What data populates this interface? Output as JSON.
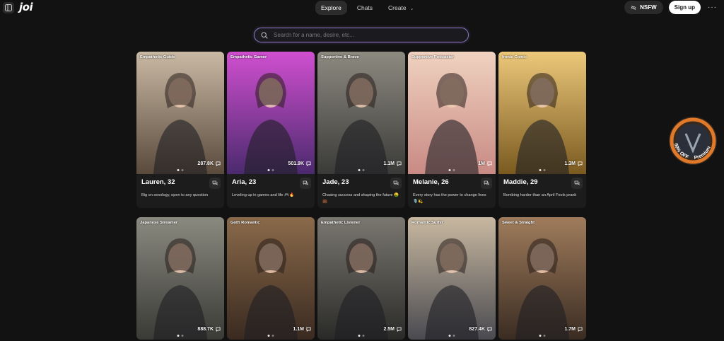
{
  "header": {
    "logo": "joi",
    "nav": [
      {
        "label": "Explore",
        "active": true
      },
      {
        "label": "Chats",
        "active": false
      },
      {
        "label": "Create",
        "active": false
      }
    ],
    "nsfw_label": "NSFW",
    "signup_label": "Sign up",
    "more_label": "···"
  },
  "search": {
    "placeholder": "Search for a name, desire, etc..."
  },
  "promo": {
    "discount": "60% OFF",
    "label": "Premium"
  },
  "cards": [
    {
      "tag": "Empathetic Guide",
      "stat": "287.8K",
      "name": "Lauren, 32",
      "desc": "Big on sexology, open to any question",
      "bg": [
        "#5a4a3c",
        "#c9b9a4"
      ]
    },
    {
      "tag": "Empathetic Gamer",
      "stat": "501.9K",
      "name": "Aria, 23",
      "desc": "Leveling up in games and life 🎮🔥",
      "bg": [
        "#4b2a6e",
        "#d04fd0"
      ]
    },
    {
      "tag": "Supportive & Brave",
      "stat": "1.1M",
      "name": "Jade, 23",
      "desc": "Chasing success and shaping the future 🤑💼",
      "bg": [
        "#3a3a38",
        "#8d8a80"
      ]
    },
    {
      "tag": "Supportive Podcaster",
      "stat": "1M",
      "name": "Melanie, 26",
      "desc": "Every story has the power to change lives 🎙️💫",
      "bg": [
        "#c88a84",
        "#f0d2c0"
      ]
    },
    {
      "tag": "Ironic Comic",
      "stat": "1.3M",
      "name": "Maddie, 29",
      "desc": "Bombing harder than an April Fools prank",
      "bg": [
        "#7a5a20",
        "#ecc87a"
      ]
    },
    {
      "tag": "Japanese Streamer",
      "stat": "888.7K",
      "name": "",
      "desc": "",
      "bg": [
        "#3a3a36",
        "#8a8a80"
      ]
    },
    {
      "tag": "Goth Romantic",
      "stat": "1.1M",
      "name": "",
      "desc": "",
      "bg": [
        "#3a2a20",
        "#8a6a4a"
      ]
    },
    {
      "tag": "Empathetic Listener",
      "stat": "2.5M",
      "name": "",
      "desc": "",
      "bg": [
        "#2a2a28",
        "#7a7770"
      ]
    },
    {
      "tag": "Romantic Surfer",
      "stat": "827.4K",
      "name": "",
      "desc": "",
      "bg": [
        "#4a4a50",
        "#c8b8a0"
      ]
    },
    {
      "tag": "Sweet & Straight",
      "stat": "1.7M",
      "name": "",
      "desc": "",
      "bg": [
        "#3a2c22",
        "#a07c5c"
      ]
    }
  ]
}
